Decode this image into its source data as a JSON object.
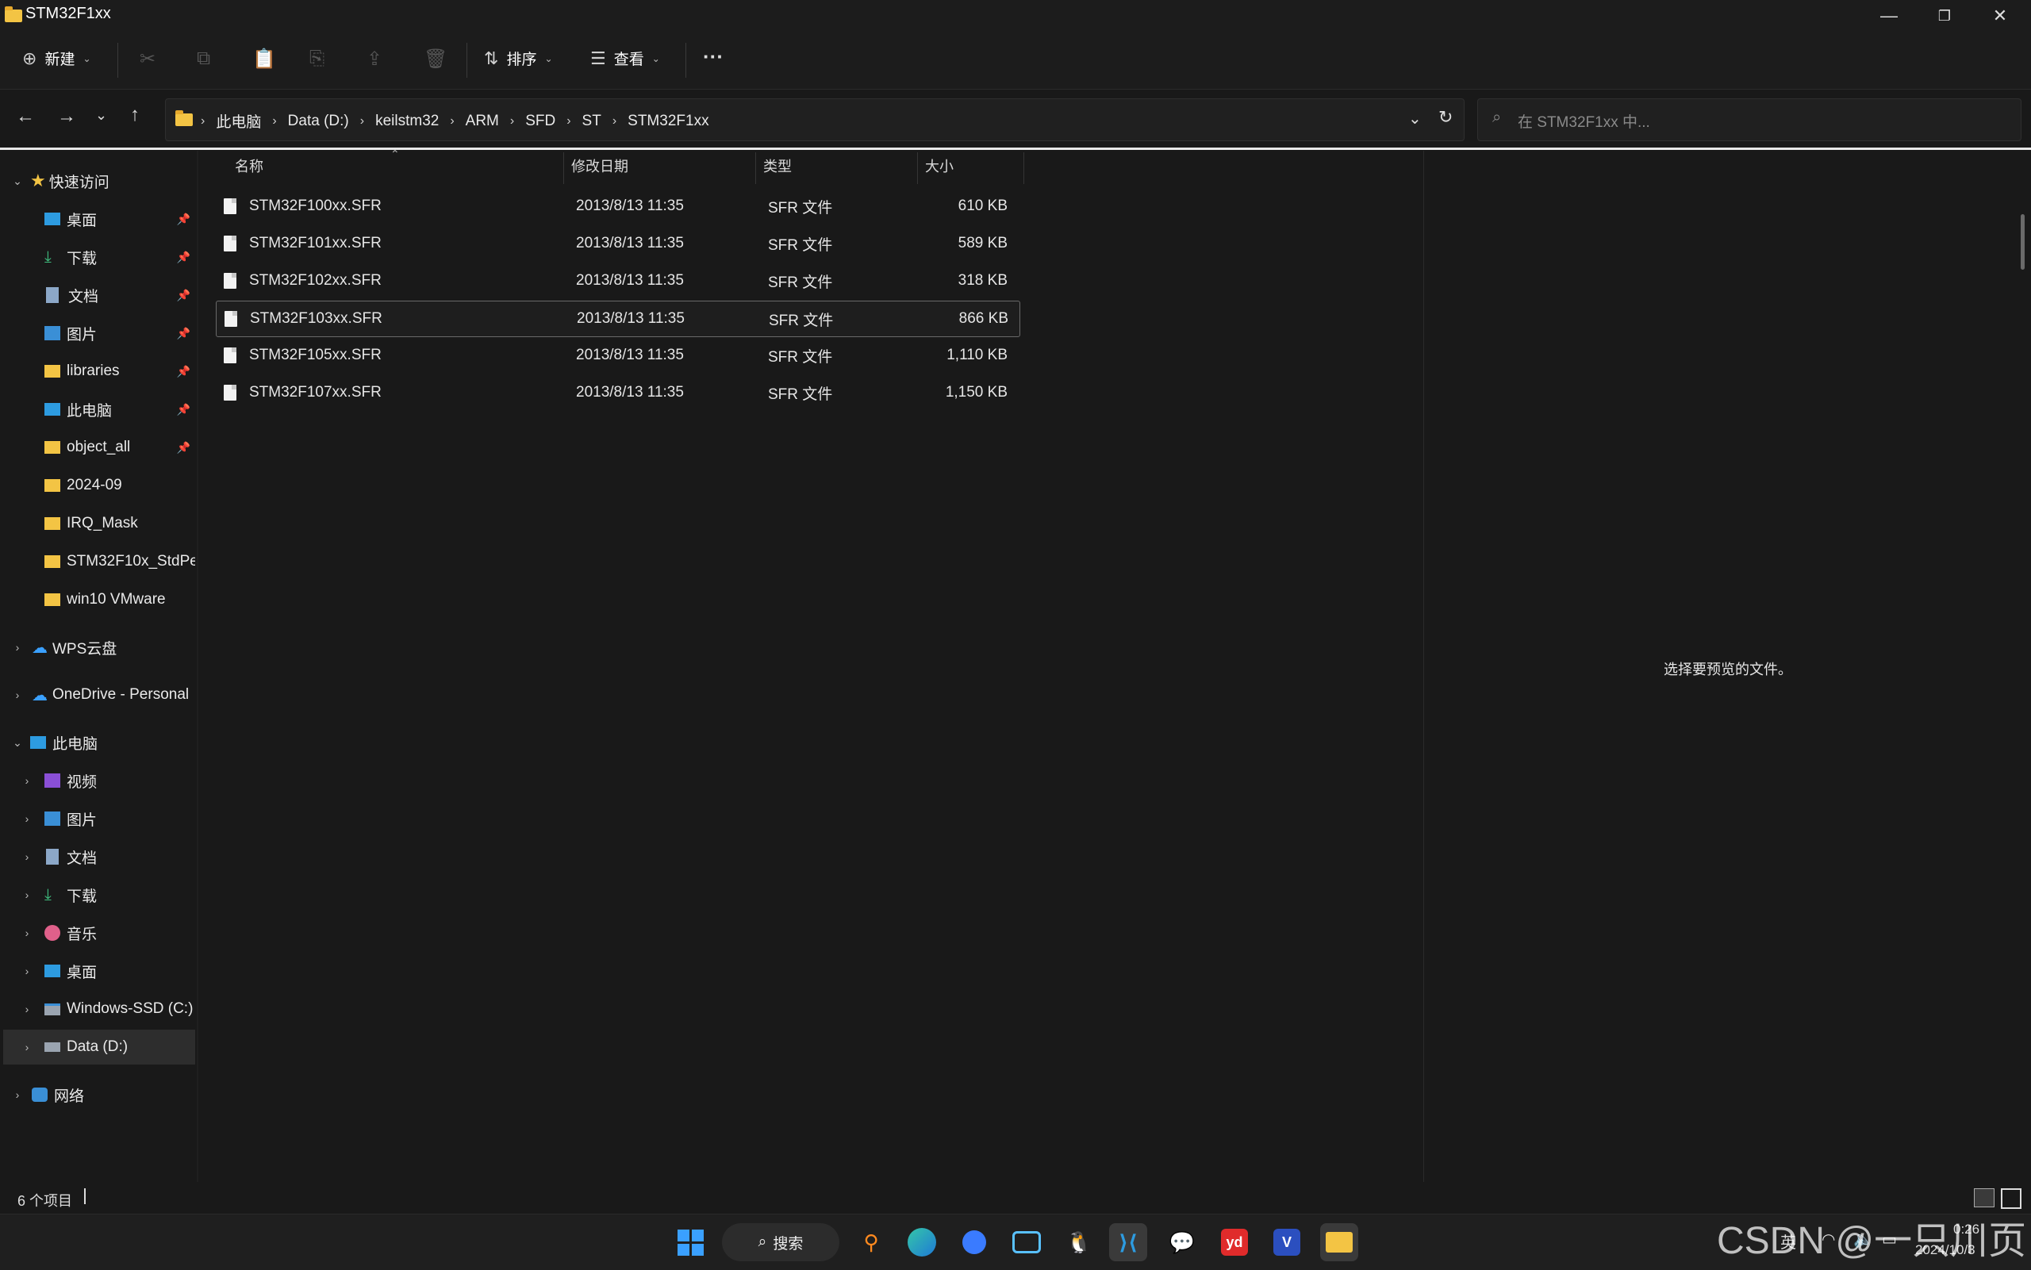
{
  "window": {
    "title": "STM32F1xx",
    "minimize": "—",
    "maximize": "❐",
    "close": "✕"
  },
  "toolbar": {
    "new_label": "新建",
    "new_icon": "plus-circle-icon",
    "sort_label": "排序",
    "view_label": "查看",
    "more_label": "···"
  },
  "address": {
    "crumbs": [
      "此电脑",
      "Data (D:)",
      "keilstm32",
      "ARM",
      "SFD",
      "ST",
      "STM32F1xx"
    ],
    "search_placeholder": "在 STM32F1xx 中..."
  },
  "nav": {
    "quick_access": "快速访问",
    "quick_items": [
      "桌面",
      "下载",
      "文档",
      "图片",
      "libraries",
      "此电脑",
      "object_all",
      "2024-09",
      "IRQ_Mask",
      "STM32F10x_StdPe",
      "win10 VMware"
    ],
    "wps": "WPS云盘",
    "onedrive": "OneDrive - Personal",
    "this_pc": "此电脑",
    "pc_items": [
      "视频",
      "图片",
      "文档",
      "下载",
      "音乐",
      "桌面",
      "Windows-SSD (C:)",
      "Data (D:)"
    ],
    "network": "网络"
  },
  "columns": {
    "name": "名称",
    "modified": "修改日期",
    "type": "类型",
    "size": "大小"
  },
  "files": [
    {
      "name": "STM32F100xx.SFR",
      "modified": "2013/8/13 11:35",
      "type": "SFR 文件",
      "size": "610 KB"
    },
    {
      "name": "STM32F101xx.SFR",
      "modified": "2013/8/13 11:35",
      "type": "SFR 文件",
      "size": "589 KB"
    },
    {
      "name": "STM32F102xx.SFR",
      "modified": "2013/8/13 11:35",
      "type": "SFR 文件",
      "size": "318 KB"
    },
    {
      "name": "STM32F103xx.SFR",
      "modified": "2013/8/13 11:35",
      "type": "SFR 文件",
      "size": "866 KB"
    },
    {
      "name": "STM32F105xx.SFR",
      "modified": "2013/8/13 11:35",
      "type": "SFR 文件",
      "size": "1,110 KB"
    },
    {
      "name": "STM32F107xx.SFR",
      "modified": "2013/8/13 11:35",
      "type": "SFR 文件",
      "size": "1,150 KB"
    }
  ],
  "preview": {
    "message": "选择要预览的文件。"
  },
  "status": {
    "count": "6 个项目"
  },
  "taskbar": {
    "search_label": "搜索",
    "ime": "英",
    "time": "0:26",
    "date": "2024/10/3",
    "watermark": "CSDN @一只川页"
  },
  "colors": {
    "accent": "#f3c444",
    "background": "#191919",
    "taskbar": "#1f1f1f"
  }
}
